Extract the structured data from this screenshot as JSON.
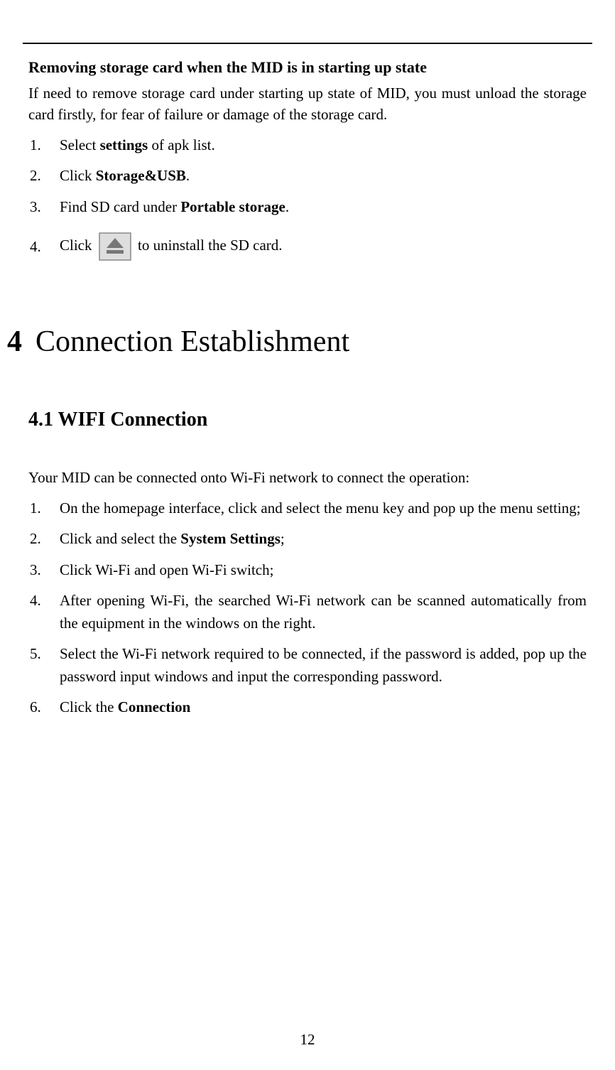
{
  "section1": {
    "heading": "Removing storage card when the MID is in starting up state",
    "intro": "If need to remove storage card under starting up state of MID, you must unload the storage card firstly, for fear of failure or damage of the storage card.",
    "steps": [
      {
        "num": "1.",
        "pre": "Select ",
        "bold": "settings",
        "post": " of apk list."
      },
      {
        "num": "2.",
        "pre": "Click ",
        "bold": "Storage&USB",
        "post": "."
      },
      {
        "num": "3.",
        "pre": "Find SD card under ",
        "bold": "Portable storage",
        "post": "."
      },
      {
        "num": "4.",
        "pre": "Click ",
        "icon": true,
        "post": " to uninstall the SD card."
      }
    ]
  },
  "chapter": {
    "num": "4",
    "title": "Connection Establishment"
  },
  "section2": {
    "title": "4.1  WIFI Connection",
    "intro": "Your MID can be connected onto Wi-Fi network to connect the operation:",
    "steps": [
      {
        "num": "1.",
        "text": "On the homepage interface, click and select the menu key and pop up the menu setting;"
      },
      {
        "num": "2.",
        "pre": "Click and select the ",
        "bold": "System Settings",
        "post": ";"
      },
      {
        "num": "3.",
        "text": "Click Wi-Fi and open Wi-Fi switch;"
      },
      {
        "num": "4.",
        "text": "After opening Wi-Fi, the searched Wi-Fi network can be scanned automatically from the equipment in the windows on the right."
      },
      {
        "num": "5.",
        "text": "Select the Wi-Fi network required to be connected, if the password is added, pop up the password input windows and input the corresponding password."
      },
      {
        "num": "6.",
        "pre": "Click the ",
        "bold": "Connection",
        "post": ""
      }
    ]
  },
  "pageNumber": "12"
}
